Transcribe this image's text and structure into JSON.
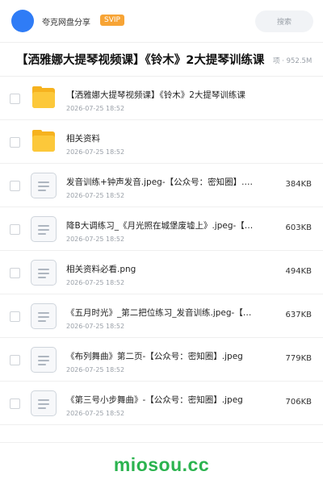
{
  "header": {
    "user_name": "夸克网盘分享",
    "badge": "SVIP",
    "search_placeholder": "搜索"
  },
  "share": {
    "title": "【洒雅娜大提琴视频课】《铃木》2大提琴训练课",
    "meta": "项 · 952.5M"
  },
  "files": [
    {
      "type": "folder",
      "icon": "folder-icon",
      "name": "【洒雅娜大提琴视频课】《铃木》2大提琴训练课",
      "date": "2026-07-25 18:52",
      "size": ""
    },
    {
      "type": "folder",
      "icon": "folder-icon",
      "name": "相关资料",
      "date": "2026-07-25 18:52",
      "size": ""
    },
    {
      "type": "file",
      "icon": "document-icon",
      "name": "发音训练+钟声发音.jpeg-【公众号：密知圈】.…",
      "date": "2026-07-25 18:52",
      "size": "384KB"
    },
    {
      "type": "file",
      "icon": "document-icon",
      "name": "降B大调练习_《月光照在城堡废墟上》.jpeg-【…",
      "date": "2026-07-25 18:52",
      "size": "603KB"
    },
    {
      "type": "file",
      "icon": "document-icon",
      "name": "相关资料必看.png",
      "date": "2026-07-25 18:52",
      "size": "494KB"
    },
    {
      "type": "file",
      "icon": "document-icon",
      "name": "《五月时光》_第二把位练习_发音训练.jpeg-【…",
      "date": "2026-07-25 18:52",
      "size": "637KB"
    },
    {
      "type": "file",
      "icon": "document-icon",
      "name": "《布列舞曲》第二页-【公众号：密知圈】.jpeg",
      "date": "2026-07-25 18:52",
      "size": "779KB"
    },
    {
      "type": "file",
      "icon": "document-icon",
      "name": "《第三号小步舞曲》-【公众号：密知圈】.jpeg",
      "date": "2026-07-25 18:52",
      "size": "706KB"
    }
  ],
  "footer": {
    "watermark": "miosou.cc"
  },
  "colors": {
    "accent_blue": "#2f7cf6",
    "svip_orange": "#f7a435",
    "folder_yellow": "#fcc83a",
    "watermark_green": "#2bb34f"
  }
}
